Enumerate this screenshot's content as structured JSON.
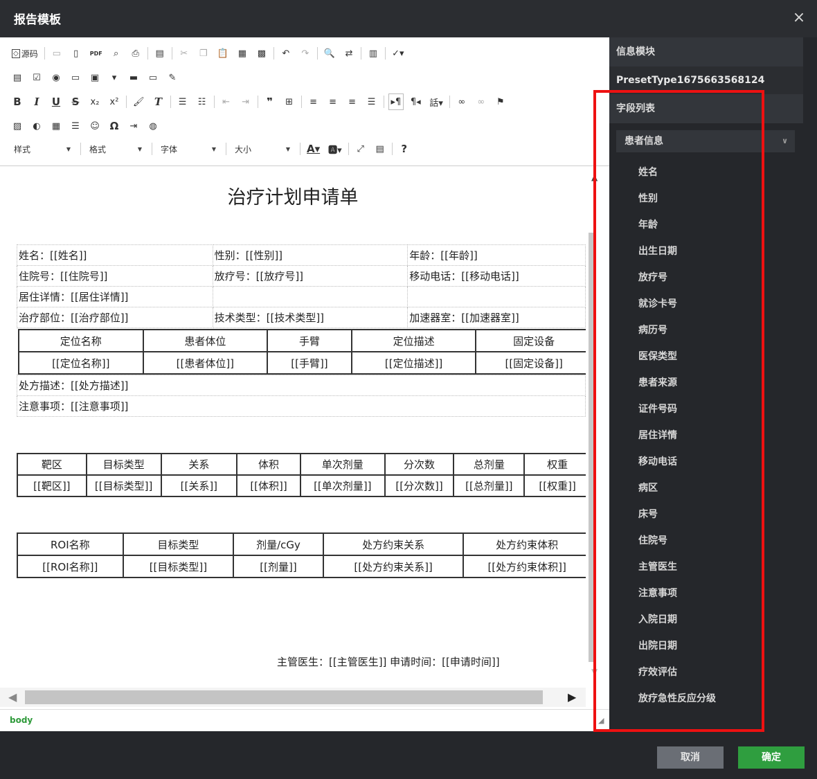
{
  "window": {
    "title": "报告模板",
    "close": "×"
  },
  "toolbar": {
    "source_label": "源码",
    "combos": {
      "style": "样式",
      "format": "格式",
      "font": "字体",
      "size": "大小"
    },
    "help": "?"
  },
  "document": {
    "title": "治疗计划申请单",
    "info_rows": [
      [
        "姓名：[[姓名]]",
        "性别：[[性别]]",
        "年龄：[[年龄]]"
      ],
      [
        "住院号：[[住院号]]",
        "放疗号：[[放疗号]]",
        "移动电话：[[移动电话]]"
      ],
      [
        "居住详情：[[居住详情]]",
        "",
        ""
      ],
      [
        "治疗部位：[[治疗部位]]",
        "技术类型：[[技术类型]]",
        "加速器室：[[加速器室]]"
      ]
    ],
    "table1": {
      "headers": [
        "定位名称",
        "患者体位",
        "手臂",
        "定位描述",
        "固定设备"
      ],
      "cells": [
        "[[定位名称]]",
        "[[患者体位]]",
        "[[手臂]]",
        "[[定位描述]]",
        "[[固定设备]]"
      ]
    },
    "info2_rows": [
      "处方描述：[[处方描述]]",
      "注意事项：[[注意事项]]"
    ],
    "table2": {
      "headers": [
        "靶区",
        "目标类型",
        "关系",
        "体积",
        "单次剂量",
        "分次数",
        "总剂量",
        "权重"
      ],
      "cells": [
        "[[靶区]]",
        "[[目标类型]]",
        "[[关系]]",
        "[[体积]]",
        "[[单次剂量]]",
        "[[分次数]]",
        "[[总剂量]]",
        "[[权重]]"
      ]
    },
    "table3": {
      "headers": [
        "ROI名称",
        "目标类型",
        "剂量/cGy",
        "处方约束关系",
        "处方约束体积"
      ],
      "cells": [
        "[[ROI名称]]",
        "[[目标类型]]",
        "[[剂量]]",
        "[[处方约束关系]]",
        "[[处方约束体积]]"
      ]
    },
    "footer": "主管医生：[[主管医生]]  申请时间：[[申请时间]]"
  },
  "statusbar": {
    "path": "body"
  },
  "panel": {
    "info_module": "信息模块",
    "preset": "PresetType1675663568124",
    "field_list_label": "字段列表",
    "selected_group": "患者信息",
    "fields": [
      "姓名",
      "性别",
      "年龄",
      "出生日期",
      "放疗号",
      "就诊卡号",
      "病历号",
      "医保类型",
      "患者来源",
      "证件号码",
      "居住详情",
      "移动电话",
      "病区",
      "床号",
      "住院号",
      "主管医生",
      "注意事项",
      "入院日期",
      "出院日期",
      "疗效评估",
      "放疗急性反应分级"
    ]
  },
  "buttons": {
    "cancel": "取消",
    "ok": "确定"
  },
  "colors": {
    "highlight": "#ee1111",
    "ok_button": "#2f9e3f",
    "panel_bg": "#25272b"
  }
}
